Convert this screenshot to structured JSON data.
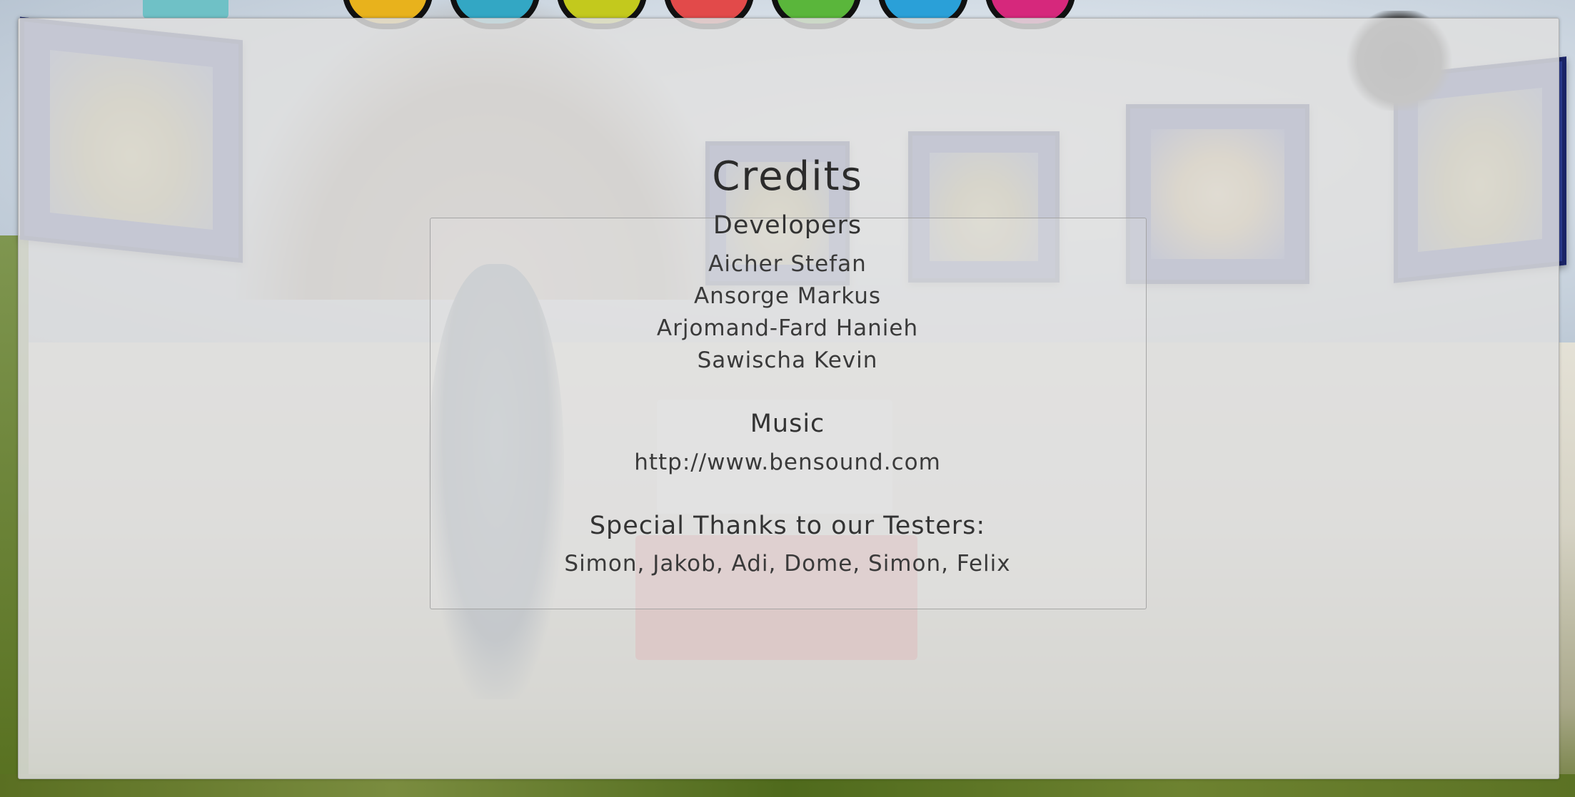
{
  "credits": {
    "title": "Credits",
    "developers_heading": "Developers",
    "developers": [
      "Aicher Stefan",
      "Ansorge Markus",
      "Arjomand-Fard Hanieh",
      "Sawischa Kevin"
    ],
    "music_heading": "Music",
    "music_url": "http://www.bensound.com",
    "testers_heading": "Special Thanks to our Testers:",
    "testers": "Simon, Jakob, Adi, Dome, Simon, Felix"
  },
  "colors": {
    "overlay": "#dedede",
    "text": "#333333"
  }
}
